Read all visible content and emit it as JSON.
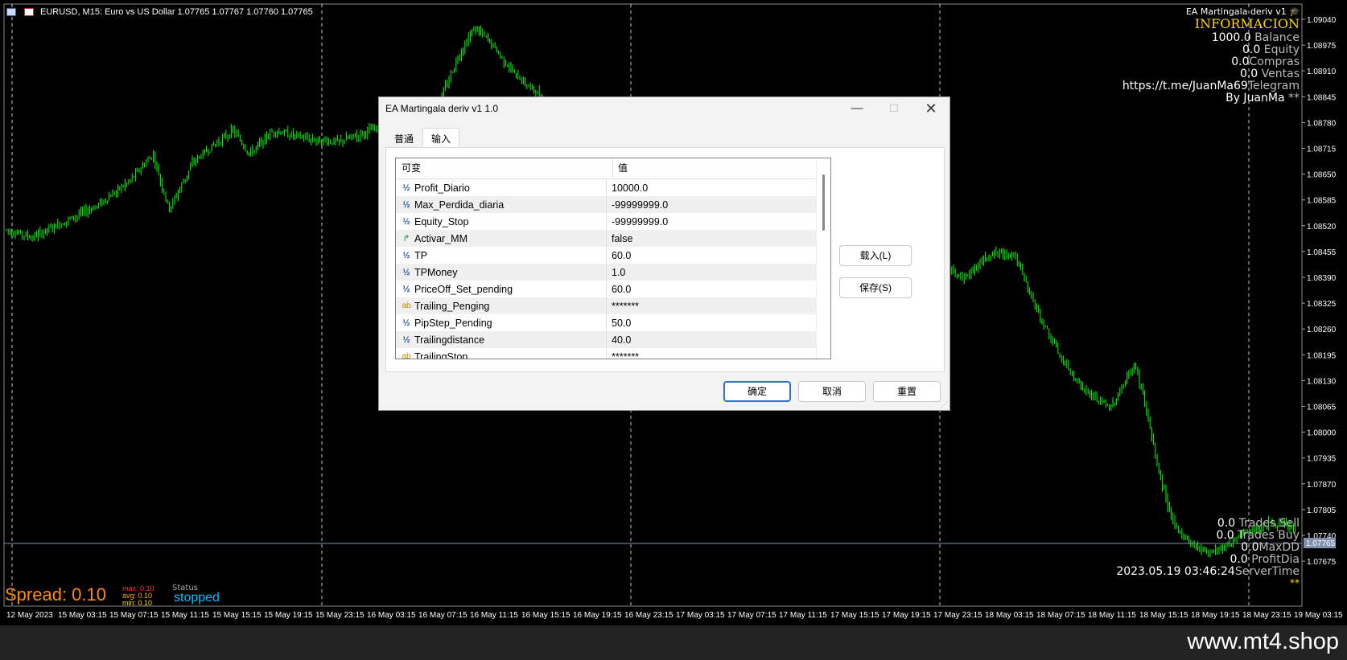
{
  "chart": {
    "symbol_line": "EURUSD, M15:  Euro vs US Dollar  1.07765 1.07767 1.07760 1.07765",
    "current_price": "1.07765",
    "y_ticks": [
      "1.09040",
      "1.08975",
      "1.08910",
      "1.08845",
      "1.08780",
      "1.08715",
      "1.08650",
      "1.08585",
      "1.08520",
      "1.08455",
      "1.08390",
      "1.08325",
      "1.08260",
      "1.08195",
      "1.08130",
      "1.08065",
      "1.08000",
      "1.07935",
      "1.07870",
      "1.07805",
      "1.07740",
      "1.07675"
    ],
    "x_ticks": [
      "12 May 2023",
      "15 May 03:15",
      "15 May 07:15",
      "15 May 11:15",
      "15 May 15:15",
      "15 May 19:15",
      "15 May 23:15",
      "16 May 03:15",
      "16 May 07:15",
      "16 May 11:15",
      "16 May 15:15",
      "16 May 19:15",
      "16 May 23:15",
      "17 May 03:15",
      "17 May 07:15",
      "17 May 11:15",
      "17 May 15:15",
      "17 May 19:15",
      "17 May 23:15",
      "18 May 03:15",
      "18 May 07:15",
      "18 May 11:15",
      "18 May 15:15",
      "18 May 19:15",
      "18 May 23:15",
      "19 May 03:15"
    ],
    "colors": {
      "candle": "#00ff00",
      "grid": "#ffffff",
      "price_line": "#8090b0",
      "background": "#000000"
    }
  },
  "info_panel": {
    "ea_label": "EA Martingala deriv v1",
    "cap_icon": "graduation-cap-icon",
    "title": "INFORMACION",
    "balance_value": "1000.0",
    "balance_label": "Balance",
    "equity_value": "0.0",
    "equity_label": "Equity",
    "compras_value": "0.0",
    "compras_label": "Compras",
    "ventas_value": "0.0",
    "ventas_label": "Ventas",
    "telegram_url": "https://t.me/JuanMa69",
    "telegram_label": "Telegram",
    "by_author": "By JuanMa",
    "stars": "**"
  },
  "stats_panel": {
    "trades_sell_value": "0.0",
    "trades_sell_label": "Trades Sell",
    "trades_buy_value": "0.0",
    "trades_buy_label": "Trades Buy",
    "maxdd_value": "0.0",
    "maxdd_label": "MaxDD",
    "profitdia_value": "0.0",
    "profitdia_label": "ProfitDia",
    "server_time_value": "2023.05.19 03:46:24",
    "server_time_label": "ServerTime",
    "stars": "**"
  },
  "spread_panel": {
    "spread_text": "Spread: 0.10",
    "max": "max: 0.10",
    "avg": "avg: 0.10",
    "min": "min: 0.10",
    "status_label": "Status",
    "status_value": "stopped"
  },
  "dialog": {
    "title": "EA Martingala deriv v1 1.0",
    "tabs": [
      "普通",
      "输入"
    ],
    "columns": [
      "可变",
      "值"
    ],
    "rows": [
      {
        "type": "num",
        "icon": "½",
        "name": "Profit_Diario",
        "value": "10000.0"
      },
      {
        "type": "num",
        "icon": "½",
        "name": "Max_Perdida_diaria",
        "value": "-99999999.0"
      },
      {
        "type": "num",
        "icon": "½",
        "name": "Equity_Stop",
        "value": "-99999999.0"
      },
      {
        "type": "bool",
        "icon": "↱",
        "name": "Activar_MM",
        "value": "false"
      },
      {
        "type": "num",
        "icon": "½",
        "name": "TP",
        "value": "60.0"
      },
      {
        "type": "num",
        "icon": "½",
        "name": "TPMoney",
        "value": "1.0"
      },
      {
        "type": "num",
        "icon": "½",
        "name": "PriceOff_Set_pending",
        "value": "60.0"
      },
      {
        "type": "str",
        "icon": "ab",
        "name": "Trailing_Penging",
        "value": "*******"
      },
      {
        "type": "num",
        "icon": "½",
        "name": "PipStep_Pending",
        "value": "50.0"
      },
      {
        "type": "num",
        "icon": "½",
        "name": "Trailingdistance",
        "value": "40.0"
      },
      {
        "type": "str",
        "icon": "ab",
        "name": "TrailingStop",
        "value": "*******"
      }
    ],
    "load_label": "载入(L)",
    "save_label": "保存(S)",
    "ok_label": "确定",
    "cancel_label": "取消",
    "reset_label": "重置"
  },
  "footer": {
    "brand": "www.mt4.shop"
  }
}
